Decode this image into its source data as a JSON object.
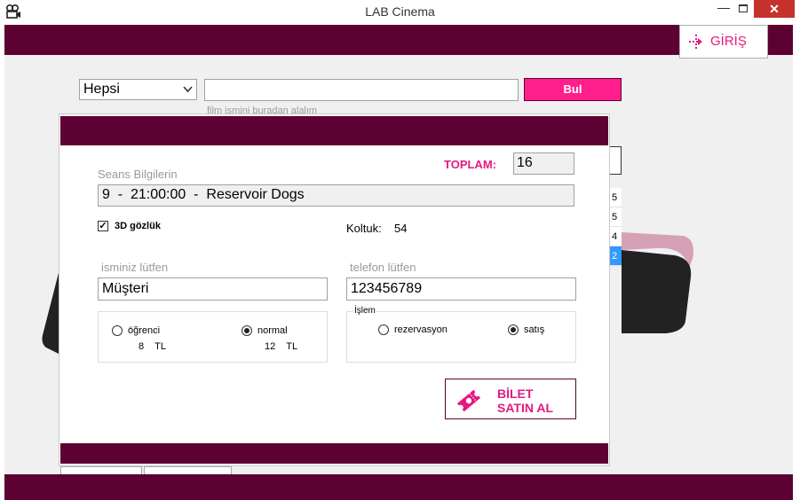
{
  "window": {
    "title": "LAB Cinema",
    "minimize_glyph": "—",
    "close_glyph": "✕"
  },
  "header": {
    "login_label": "GİRİŞ"
  },
  "search": {
    "category_value": "Hepsi",
    "query_value": "",
    "hint": "film ismini buradan alalım",
    "find_label": "Bul"
  },
  "background_list": {
    "items": [
      "5",
      "5",
      "4",
      "2"
    ],
    "selected_index": 3
  },
  "dialog": {
    "total_label": "TOPLAM:",
    "total_value": "16",
    "session_label": "Seans Bilgilerin",
    "session_value": "9  -  21:00:00  -  Reservoir Dogs",
    "glasses_label": "3D gözlük",
    "glasses_checked": true,
    "seat_label": "Koltuk:",
    "seat_value": "54",
    "name_label": "isminiz lütfen",
    "name_value": "Müşteri",
    "phone_label": "telefon lütfen",
    "phone_value": "123456789",
    "ticket_type": {
      "student_label": "öğrenci",
      "student_price": "8    TL",
      "normal_label": "normal",
      "normal_price": "12    TL",
      "selected": "normal"
    },
    "operation": {
      "title": "İşlem",
      "reservation_label": "rezervasyon",
      "sale_label": "satış",
      "selected": "sale"
    },
    "buy_line1": "BİLET",
    "buy_line2": "SATIN AL"
  },
  "colors": {
    "brand": "#5d0032",
    "accent": "#e6187f",
    "button": "#ff1e8c"
  },
  "icons": {
    "app": "film-camera-icon",
    "login": "login-arrow-icon",
    "buy": "ticket-icon"
  }
}
